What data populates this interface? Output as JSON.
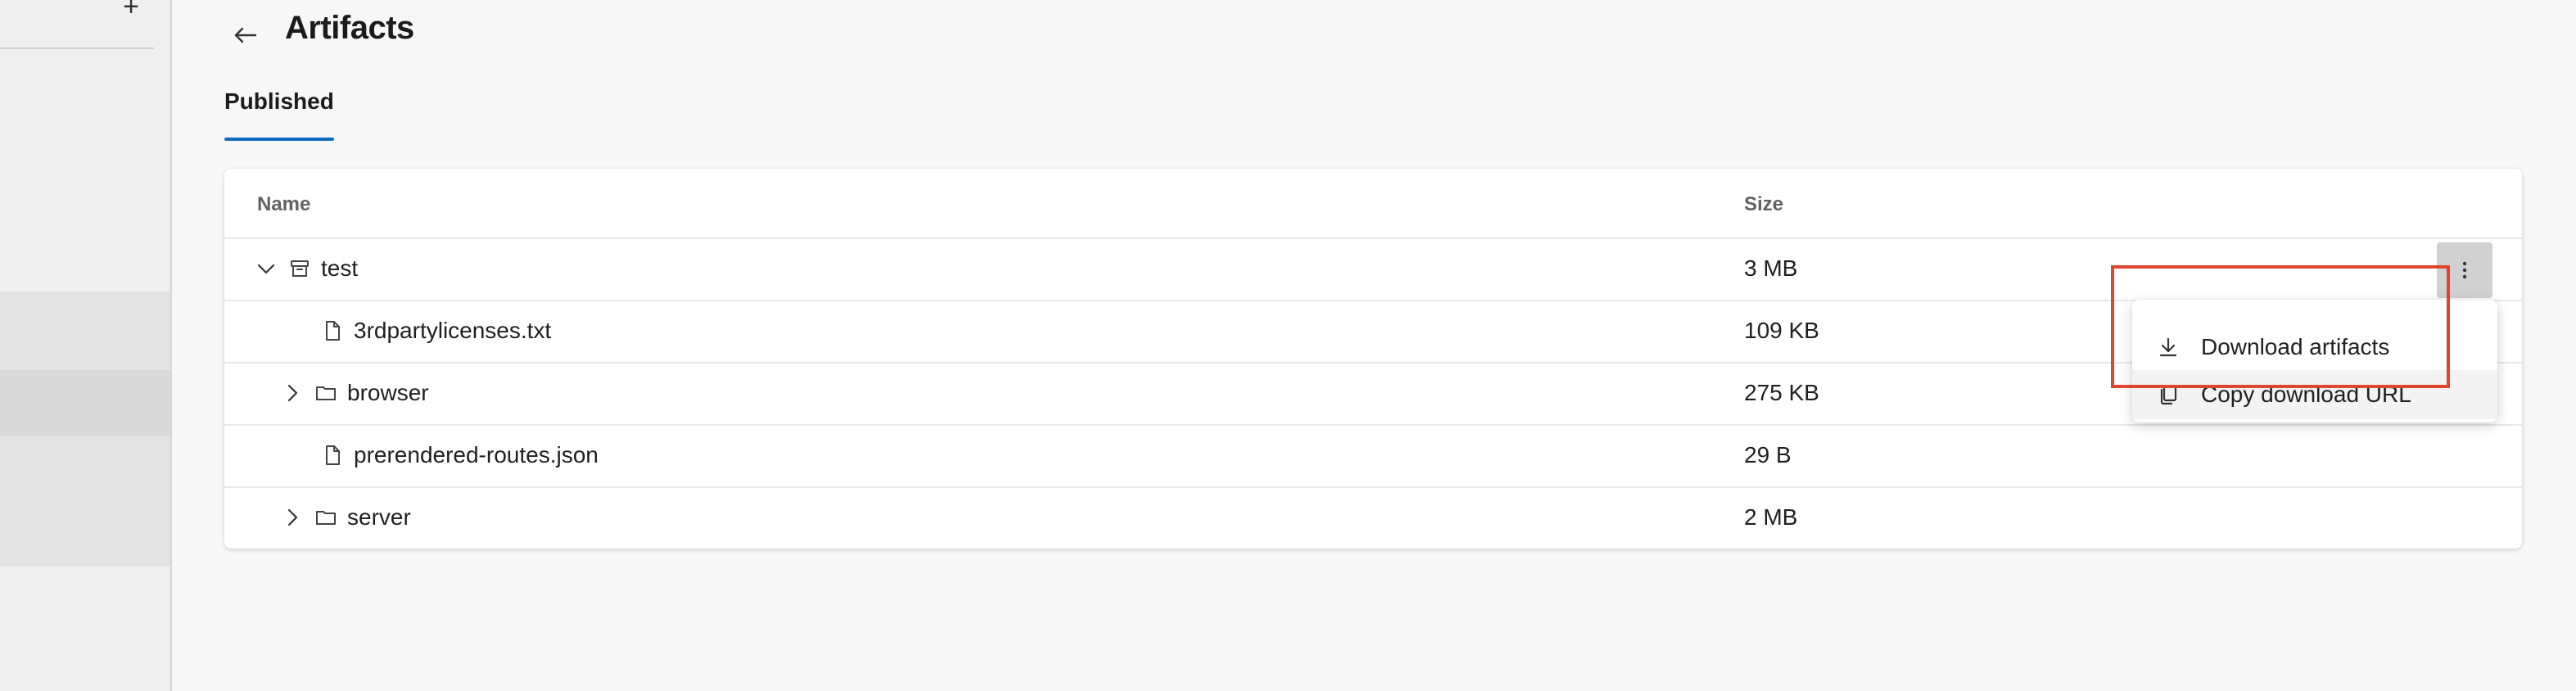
{
  "header": {
    "title": "Artifacts",
    "tabs": [
      {
        "label": "Published",
        "active": true
      }
    ]
  },
  "table": {
    "columns": [
      "Name",
      "Size"
    ],
    "rows": [
      {
        "name": "test",
        "size": "3 MB",
        "icon": "artifact-icon",
        "expander": "chevron-down-icon"
      },
      {
        "name": "3rdpartylicenses.txt",
        "size": "109 KB",
        "icon": "file-icon"
      },
      {
        "name": "browser",
        "size": "275 KB",
        "icon": "folder-icon",
        "expander": "chevron-right-icon"
      },
      {
        "name": "prerendered-routes.json",
        "size": "29 B",
        "icon": "file-icon"
      },
      {
        "name": "server",
        "size": "2 MB",
        "icon": "folder-icon",
        "expander": "chevron-right-icon"
      }
    ]
  },
  "context_menu": {
    "items": [
      {
        "label": "Download artifacts",
        "icon": "download-icon"
      },
      {
        "label": "Copy download URL",
        "icon": "copy-icon"
      }
    ]
  },
  "colors": {
    "accent": "#0f6cbd",
    "highlight_box": "#e0462d"
  }
}
